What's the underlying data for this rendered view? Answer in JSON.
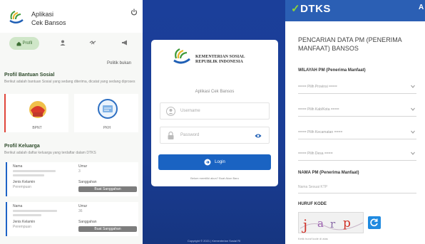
{
  "panel1": {
    "app_title_line1": "Aplikasi",
    "app_title_line2": "Cek Bansos",
    "nav_active_label": "Profil",
    "nav_right_link": "Politik bukan",
    "bansos_section_title": "Profil Bantuan Sosial",
    "bansos_section_sub": "Berikut adalah bantuan Sosial yang sedang diterima, dicatat yang sedang diproses",
    "card1_label": "BPNT",
    "card2_label": "PKH",
    "keluarga_section_title": "Profil Keluarga",
    "keluarga_section_sub": "Berikut adalah daftar keluarga yang terdaftar dalam DTKS",
    "family_rows": [
      {
        "nama_label": "Nama",
        "umur_label": "Umur",
        "umur_value": "3",
        "jk_label": "Jenis Kelamin",
        "jk_value": "Perempuan",
        "sanggahan_label": "Sanggahan",
        "button_label": "Buat Sanggahan"
      },
      {
        "nama_label": "Nama",
        "umur_label": "Umur",
        "umur_value": "36",
        "jk_label": "Jenis Kelamin",
        "jk_value": "Perempuan",
        "sanggahan_label": "Sanggahan",
        "button_label": "Buat Sanggahan"
      }
    ],
    "colors": {
      "accent_green": "#cfe6c8",
      "card_red": "#e0463b",
      "family_blue": "#1e63c6"
    }
  },
  "panel2": {
    "ministry_name_line1": "KEMENTERIAN SOSIAL",
    "ministry_name_line2": "REPUBLIK INDONESIA",
    "app_name": "Aplikasi Cek Bansos",
    "username_placeholder": "Username",
    "password_placeholder": "Password",
    "login_button": "Login",
    "register_note": "Belum memiliki akun? Buat Akun Baru",
    "footer": "Copyright © 2021 | Kementerian Sosial RI",
    "colors": {
      "background": "#1b3f9a",
      "button": "#1a63c2"
    }
  },
  "panel3": {
    "logo_letters": "DTKS",
    "header_right": "A",
    "title": "PENCARIAN DATA PM (PENERIMA MANFAAT) BANSOS",
    "wilayah_label": "WILAYAH PM (Penerima Manfaat)",
    "selects": [
      "==== Pilih Provinsi ====",
      "==== Pilih Kab/Kota ====",
      "==== Pilih Kecamatan ====",
      "==== Pilih Desa ===="
    ],
    "nama_label": "NAMA PM (Penerima Manfaat)",
    "nama_placeholder": "Nama Sesuai KTP",
    "huruf_kode_label": "HURUF KODE",
    "captcha_text": "jarp",
    "captcha_note": "Ketik huruf kode di atas",
    "colors": {
      "header": "#2b5fb4",
      "logo_accent": "#8bd33a",
      "refresh": "#1f8ae0"
    }
  }
}
